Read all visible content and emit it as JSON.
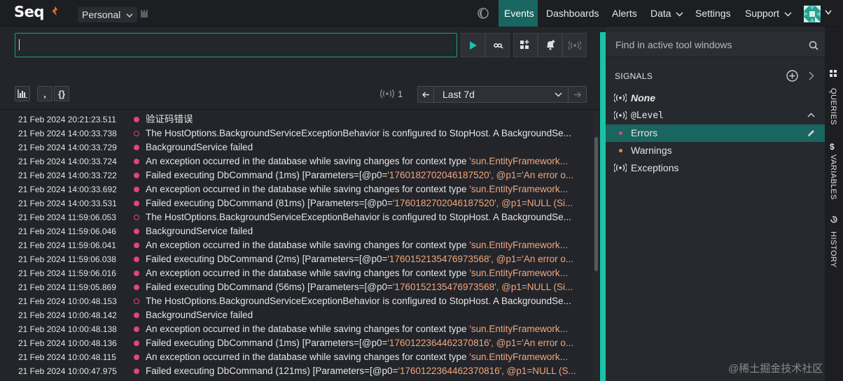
{
  "nav": {
    "logo": "Seq",
    "workspace": "Personal",
    "items": [
      "Events",
      "Dashboards",
      "Alerts",
      "Data",
      "Settings",
      "Support"
    ],
    "active": "Events"
  },
  "search": {
    "value": ""
  },
  "toolbar": {
    "quote_label": ",",
    "braces_label": "{}",
    "live_count": "1",
    "range": "Last 7d"
  },
  "events": [
    {
      "time": "21 Feb 2024  20:21:23.511",
      "msg": "验证码错误",
      "hollow": false
    },
    {
      "time": "21 Feb 2024  14:00:33.738",
      "msg": "The HostOptions.BackgroundServiceExceptionBehavior is configured to StopHost. A BackgroundSe...",
      "hollow": true
    },
    {
      "time": "21 Feb 2024  14:00:33.729",
      "msg": "BackgroundService failed",
      "hollow": false
    },
    {
      "time": "21 Feb 2024  14:00:33.724",
      "msg": "An exception occurred in the database while saving changes for context type ",
      "val": "'sun.EntityFramework...",
      "hollow": false
    },
    {
      "time": "21 Feb 2024  14:00:33.722",
      "msg": "Failed executing DbCommand (1ms) [Parameters=[@p0=",
      "val": "'1760182702046187520', @p1='An error o...",
      "hollow": false
    },
    {
      "time": "21 Feb 2024  14:00:33.692",
      "msg": "An exception occurred in the database while saving changes for context type ",
      "val": "'sun.EntityFramework...",
      "hollow": false
    },
    {
      "time": "21 Feb 2024  14:00:33.531",
      "msg": "Failed executing DbCommand (81ms) [Parameters=[@p0=",
      "val": "'1760182702046187520', @p1=NULL (Si...",
      "hollow": false
    },
    {
      "time": "21 Feb 2024  11:59:06.053",
      "msg": "The HostOptions.BackgroundServiceExceptionBehavior is configured to StopHost. A BackgroundSe...",
      "hollow": true
    },
    {
      "time": "21 Feb 2024  11:59:06.046",
      "msg": "BackgroundService failed",
      "hollow": false
    },
    {
      "time": "21 Feb 2024  11:59:06.041",
      "msg": "An exception occurred in the database while saving changes for context type ",
      "val": "'sun.EntityFramework...",
      "hollow": false
    },
    {
      "time": "21 Feb 2024  11:59:06.038",
      "msg": "Failed executing DbCommand (2ms) [Parameters=[@p0=",
      "val": "'1760152135476973568', @p1='An error o...",
      "hollow": false
    },
    {
      "time": "21 Feb 2024  11:59:06.016",
      "msg": "An exception occurred in the database while saving changes for context type ",
      "val": "'sun.EntityFramework...",
      "hollow": false
    },
    {
      "time": "21 Feb 2024  11:59:05.869",
      "msg": "Failed executing DbCommand (56ms) [Parameters=[@p0=",
      "val": "'1760152135476973568', @p1=NULL (Si...",
      "hollow": false
    },
    {
      "time": "21 Feb 2024  10:00:48.153",
      "msg": "The HostOptions.BackgroundServiceExceptionBehavior is configured to StopHost. A BackgroundSe...",
      "hollow": true
    },
    {
      "time": "21 Feb 2024  10:00:48.142",
      "msg": "BackgroundService failed",
      "hollow": false
    },
    {
      "time": "21 Feb 2024  10:00:48.138",
      "msg": "An exception occurred in the database while saving changes for context type ",
      "val": "'sun.EntityFramework...",
      "hollow": false
    },
    {
      "time": "21 Feb 2024  10:00:48.136",
      "msg": "Failed executing DbCommand (1ms) [Parameters=[@p0=",
      "val": "'1760122364462370816', @p1='An error o...",
      "hollow": false
    },
    {
      "time": "21 Feb 2024  10:00:48.115",
      "msg": "An exception occurred in the database while saving changes for context type ",
      "val": "'sun.EntityFramework...",
      "hollow": false
    },
    {
      "time": "21 Feb 2024  10:00:47.975",
      "msg": "Failed executing DbCommand (121ms) [Parameters=[@p0=",
      "val": "'1760122364462370816', @p1=NULL (S...",
      "hollow": false
    }
  ],
  "right": {
    "find_placeholder": "Find in active tool windows",
    "signals_title": "SIGNALS",
    "signals": {
      "none": "None",
      "level": "@Level",
      "errors": "Errors",
      "warnings": "Warnings",
      "exceptions": "Exceptions"
    },
    "strip": [
      "QUERIES",
      "VARIABLES",
      "HISTORY"
    ]
  },
  "colors": {
    "accent": "#1ac3a5",
    "active_nav": "#19655f",
    "error": "#e0467a",
    "warning": "#f08c3a",
    "value": "#f2a77e"
  },
  "watermark": "@稀土掘金技术社区"
}
